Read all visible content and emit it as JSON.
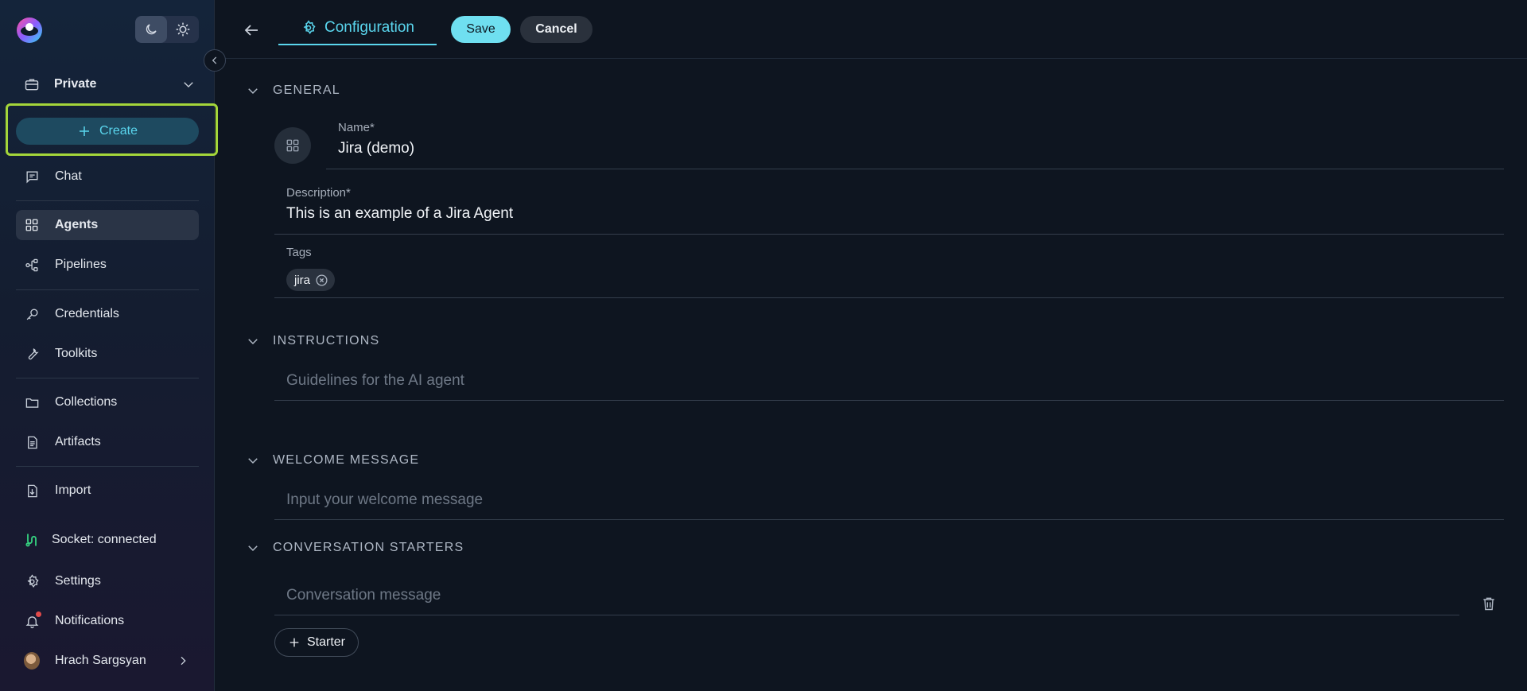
{
  "sidebar": {
    "project": "Private",
    "create_label": "Create",
    "nav": [
      {
        "label": "Chat",
        "icon": "chat-icon"
      },
      {
        "label": "Agents",
        "icon": "grid-icon",
        "active": true
      },
      {
        "label": "Pipelines",
        "icon": "pipeline-icon"
      },
      {
        "label": "Credentials",
        "icon": "key-icon"
      },
      {
        "label": "Toolkits",
        "icon": "wrench-icon"
      },
      {
        "label": "Collections",
        "icon": "folder-icon"
      },
      {
        "label": "Artifacts",
        "icon": "file-icon"
      },
      {
        "label": "Import",
        "icon": "import-icon"
      }
    ],
    "socket_status": "Socket: connected",
    "settings_label": "Settings",
    "notifications_label": "Notifications",
    "user_name": "Hrach Sargsyan"
  },
  "topbar": {
    "tab_label": "Configuration",
    "save_label": "Save",
    "cancel_label": "Cancel"
  },
  "general": {
    "title": "GENERAL",
    "name_label": "Name*",
    "name_value": "Jira (demo)",
    "description_label": "Description*",
    "description_value": "This is an example of a Jira Agent",
    "tags_label": "Tags",
    "tags": [
      "jira"
    ]
  },
  "instructions": {
    "title": "INSTRUCTIONS",
    "placeholder": "Guidelines for the AI agent"
  },
  "welcome": {
    "title": "WELCOME MESSAGE",
    "placeholder": "Input your welcome message"
  },
  "starters": {
    "title": "CONVERSATION STARTERS",
    "placeholder": "Conversation message",
    "add_label": "Starter"
  },
  "colors": {
    "accent": "#5ad6ee",
    "save_bg": "#6fdff0",
    "highlight": "#a4d63a",
    "socket": "#35d07f"
  }
}
